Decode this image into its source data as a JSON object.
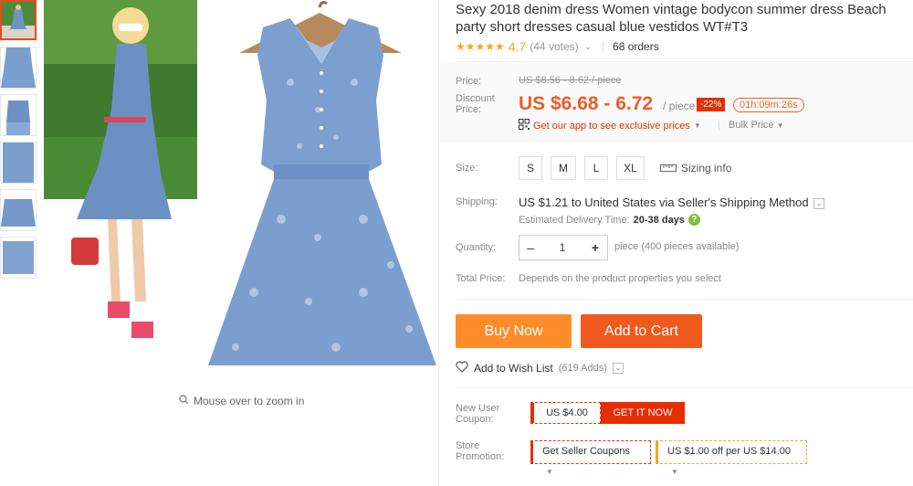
{
  "product": {
    "title": "Sexy 2018 denim dress Women vintage bodycon summer dress Beach party short dresses casual blue vestidos WT#T3",
    "stars": "★★★★★",
    "rating": "4.7",
    "votes": "(44 votes)",
    "orders": "68 orders"
  },
  "gallery": {
    "zoom_hint": "Mouse over to zoom in"
  },
  "pricing": {
    "price_label": "Price:",
    "old_price": "US $8.56 - 8.62 / piece",
    "discount_label": "Discount Price:",
    "current_price": "US $6.68 - 6.72",
    "per_piece": "/ piece",
    "discount_badge": "-22%",
    "timer": "01h:09m:26s",
    "app_prompt": "Get our app to see exclusive prices",
    "bulk_price": "Bulk Price"
  },
  "size": {
    "label": "Size:",
    "options": [
      "S",
      "M",
      "L",
      "XL"
    ],
    "size_info": "Sizing info"
  },
  "shipping": {
    "label": "Shipping:",
    "cost": "US $1.21",
    "to_prefix": "to",
    "destination": "United States via Seller's Shipping Method",
    "delivery_label": "Estimated Delivery Time:",
    "delivery_time": "20-38 days"
  },
  "quantity": {
    "label": "Quantity:",
    "value": "1",
    "available": "piece (400 pieces available)"
  },
  "total": {
    "label": "Total Price:",
    "note": "Depends on the product properties you select"
  },
  "actions": {
    "buy_now": "Buy Now",
    "add_to_cart": "Add to Cart",
    "wish_list": "Add to Wish List",
    "wish_count": "(619 Adds)"
  },
  "coupons": {
    "new_user_label": "New User Coupon:",
    "new_user_amount": "US $4.00",
    "get_it_now": "GET IT NOW",
    "store_label": "Store Promotion:",
    "seller_coupons": "Get Seller Coupons",
    "store_offer": "US $1.00 off per US $14.00"
  },
  "colors": {
    "accent": "#f05a28",
    "buy_now": "#ff8c2b",
    "add_to_cart": "#f05a1e",
    "badge_red": "#e62e04",
    "star": "#f5a623"
  }
}
